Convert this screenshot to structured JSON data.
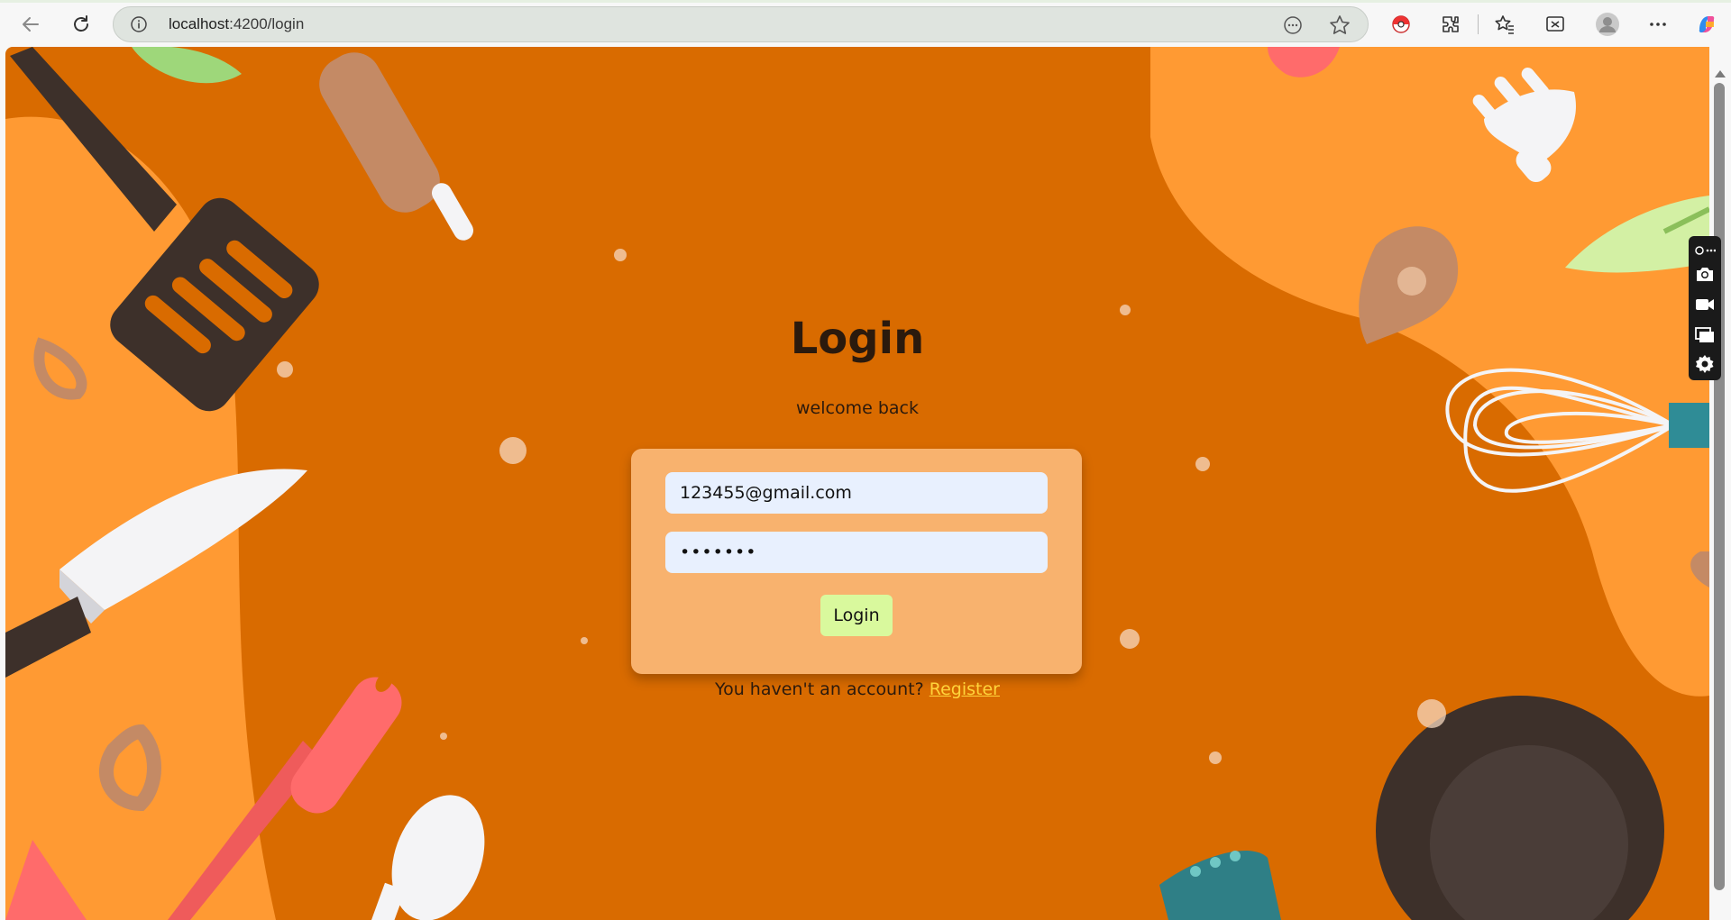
{
  "browser": {
    "url_host": "localhost",
    "url_path": ":4200/login"
  },
  "page": {
    "title": "Login",
    "subtitle": "welcome back",
    "email_value": "123455@gmail.com",
    "password_value": "•••••••",
    "login_button": "Login",
    "register_prompt": "You haven't an account?",
    "register_link": "Register"
  },
  "colors": {
    "background": "#d96b00",
    "card": "#f8b26e",
    "input": "#e8f0fe",
    "button": "#d9f99d",
    "link": "#ffd43b"
  }
}
